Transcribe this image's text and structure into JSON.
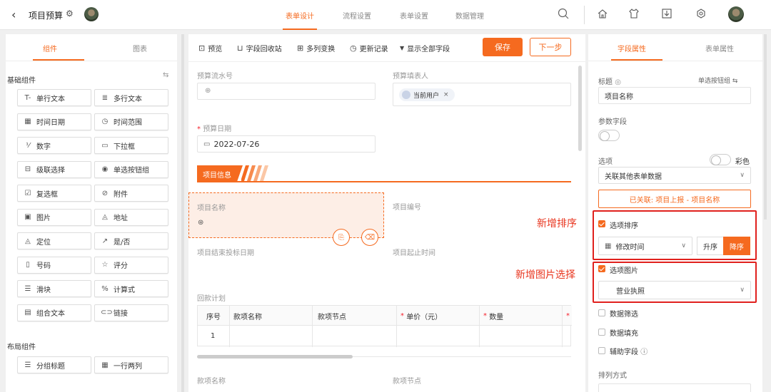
{
  "header": {
    "back_icon": "chevron-left-icon",
    "title": "项目预算",
    "tabs": [
      "表单设计",
      "流程设置",
      "表单设置",
      "数据管理"
    ],
    "active_tab": 0
  },
  "left_panel": {
    "tabs": [
      "组件",
      "图表"
    ],
    "basic_section": "基础组件",
    "basic_components": [
      "单行文本",
      "多行文本",
      "时间日期",
      "时间范围",
      "数字",
      "下拉框",
      "级联选择",
      "单选按钮组",
      "复选框",
      "附件",
      "图片",
      "地址",
      "定位",
      "是/否",
      "号码",
      "评分",
      "滑块",
      "计算式",
      "组合文本",
      "链接"
    ],
    "basic_icons": [
      "T-",
      "≣",
      "▦",
      "◷",
      "⅟",
      "▭",
      "⊟",
      "◉",
      "☑",
      "⊘",
      "▣",
      "◬",
      "◬",
      "↗",
      "▯",
      "☆",
      "☰",
      "%",
      "▤",
      "⊂⊃"
    ],
    "layout_section": "布局组件",
    "layout_components": [
      "分组标题",
      "一行两列"
    ],
    "layout_icons": [
      "☰",
      "▦"
    ]
  },
  "toolbar": {
    "preview": "预览",
    "recycle": "字段回收站",
    "multi_col": "多列变换",
    "history": "更新记录",
    "show_all": "显示全部字段",
    "save": "保存",
    "next": "下一步"
  },
  "canvas": {
    "serial_label": "预算流水号",
    "filler_label": "预算填表人",
    "current_user": "当前用户",
    "date_label": "预算日期",
    "date_value": "2022-07-26",
    "section_title": "项目信息",
    "project_name_label": "项目名称",
    "project_no_label": "项目编号",
    "bid_end_label": "项目结束投标日期",
    "start_time_label": "项目起止时间",
    "payment_plan_label": "回款计划",
    "table_headers": [
      "序号",
      "款项名称",
      "款项节点",
      "单价（元）",
      "数量"
    ],
    "table_row_index": "1",
    "bottom_left_label": "款项名称",
    "bottom_right_label": "款项节点"
  },
  "right_panel": {
    "tabs": [
      "字段属性",
      "表单属性"
    ],
    "title_label": "标题",
    "field_type": "单选按钮组",
    "title_value": "项目名称",
    "param_label": "参数字段",
    "options_label": "选项",
    "color_label": "彩色",
    "options_source": "关联其他表单数据",
    "linked_text": "已关联: 项目上报 - 项目名称",
    "sort_label": "选项排序",
    "sort_field": "修改时间",
    "asc": "升序",
    "desc": "降序",
    "image_label": "选项图片",
    "image_field": "营业执照",
    "filter_label": "数据筛选",
    "fill_label": "数据填充",
    "aux_label": "辅助字段",
    "arrange_label": "排列方式"
  },
  "annotations": {
    "sort": "新增排序",
    "image": "新增图片选择"
  },
  "colors": {
    "accent": "#f56a1f",
    "annotation": "#e0201d"
  }
}
